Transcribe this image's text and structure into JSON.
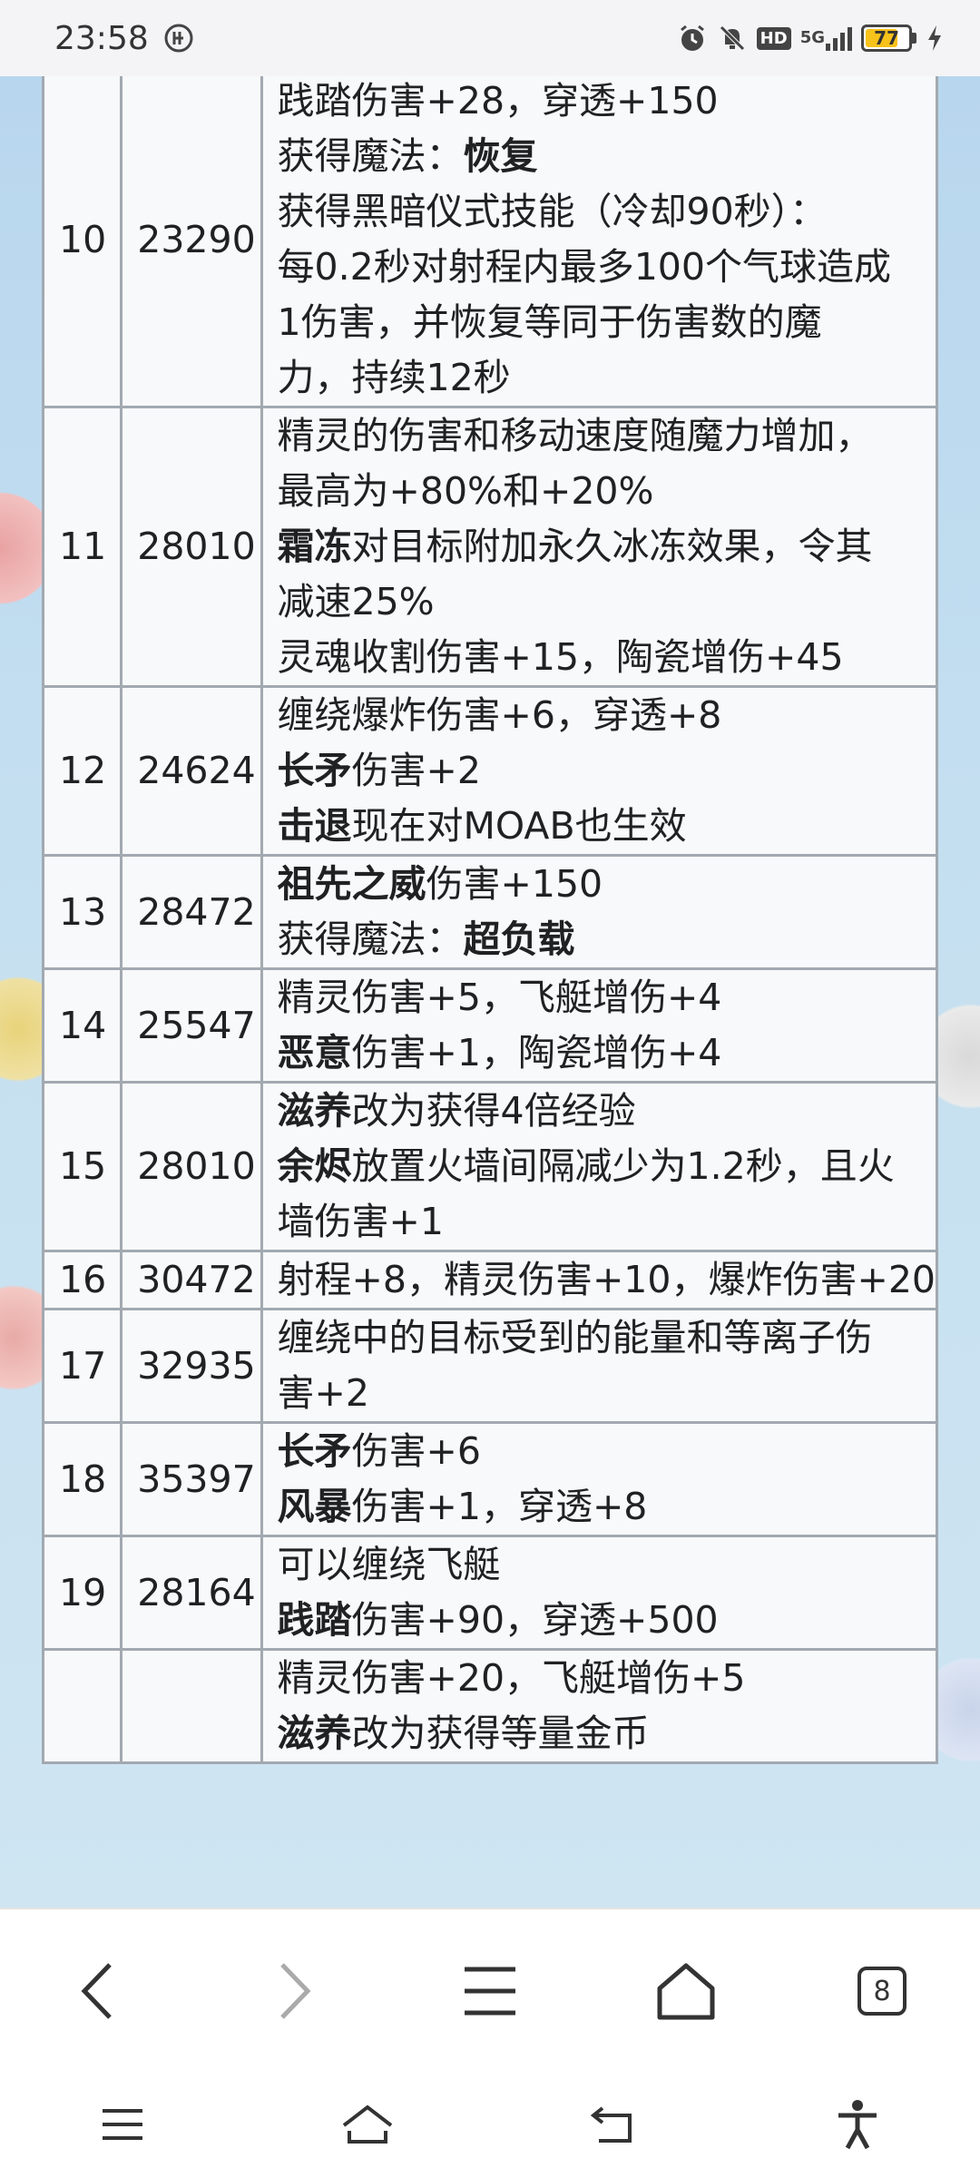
{
  "status_bar": {
    "time": "23:58",
    "network_label": "5G",
    "hd_label": "HD",
    "battery_level": "77",
    "icons": [
      "alarm-icon",
      "mute-icon",
      "hd-icon",
      "signal-icon",
      "battery-icon",
      "charging-icon"
    ]
  },
  "table": {
    "rows": [
      {
        "level": "10",
        "xp": "23290",
        "lines": [
          [
            {
              "t": "践踏伤害+28，穿透+150"
            }
          ],
          [
            {
              "t": "获得魔法："
            },
            {
              "t": "恢复",
              "b": true
            }
          ],
          [
            {
              "t": "获得黑暗仪式技能（冷却90秒）："
            }
          ],
          [
            {
              "t": "每0.2秒对射程内最多100个气球造成"
            }
          ],
          [
            {
              "t": "1伤害，并恢复等同于伤害数的魔"
            }
          ],
          [
            {
              "t": "力，持续12秒"
            }
          ]
        ]
      },
      {
        "level": "11",
        "xp": "28010",
        "lines": [
          [
            {
              "t": "精灵的伤害和移动速度随魔力增加，"
            }
          ],
          [
            {
              "t": "最高为+80%和+20%"
            }
          ],
          [
            {
              "t": "霜冻",
              "b": true
            },
            {
              "t": "对目标附加永久冰冻效果，令其"
            }
          ],
          [
            {
              "t": "减速25%"
            }
          ],
          [
            {
              "t": "灵魂收割伤害+15，陶瓷增伤+45"
            }
          ]
        ]
      },
      {
        "level": "12",
        "xp": "24624",
        "lines": [
          [
            {
              "t": "缠绕爆炸伤害+6，穿透+8"
            }
          ],
          [
            {
              "t": "长矛",
              "b": true
            },
            {
              "t": "伤害+2"
            }
          ],
          [
            {
              "t": "击退",
              "b": true
            },
            {
              "t": "现在对MOAB也生效"
            }
          ]
        ]
      },
      {
        "level": "13",
        "xp": "28472",
        "lines": [
          [
            {
              "t": "祖先之威",
              "b": true
            },
            {
              "t": "伤害+150"
            }
          ],
          [
            {
              "t": "获得魔法："
            },
            {
              "t": "超负载",
              "b": true
            }
          ]
        ]
      },
      {
        "level": "14",
        "xp": "25547",
        "lines": [
          [
            {
              "t": "精灵伤害+5，飞艇增伤+4"
            }
          ],
          [
            {
              "t": "恶意",
              "b": true
            },
            {
              "t": "伤害+1，陶瓷增伤+4"
            }
          ]
        ]
      },
      {
        "level": "15",
        "xp": "28010",
        "lines": [
          [
            {
              "t": "滋养",
              "b": true
            },
            {
              "t": "改为获得4倍经验"
            }
          ],
          [
            {
              "t": "余烬",
              "b": true
            },
            {
              "t": "放置火墙间隔减少为1.2秒，且火"
            }
          ],
          [
            {
              "t": "墙伤害+1"
            }
          ]
        ]
      },
      {
        "level": "16",
        "xp": "30472",
        "lines": [
          [
            {
              "t": "射程+8，精灵伤害+10，爆炸伤害+20"
            }
          ]
        ]
      },
      {
        "level": "17",
        "xp": "32935",
        "lines": [
          [
            {
              "t": "缠绕中的目标受到的能量和等离子伤"
            }
          ],
          [
            {
              "t": "害+2"
            }
          ]
        ]
      },
      {
        "level": "18",
        "xp": "35397",
        "lines": [
          [
            {
              "t": "长矛",
              "b": true
            },
            {
              "t": "伤害+6"
            }
          ],
          [
            {
              "t": "风暴",
              "b": true
            },
            {
              "t": "伤害+1，穿透+8"
            }
          ]
        ]
      },
      {
        "level": "19",
        "xp": "28164",
        "lines": [
          [
            {
              "t": "可以缠绕飞艇"
            }
          ],
          [
            {
              "t": "践踏",
              "b": true
            },
            {
              "t": "伤害+90，穿透+500"
            }
          ]
        ]
      },
      {
        "level": "",
        "xp": "",
        "lines": [
          [
            {
              "t": "精灵伤害+20，飞艇增伤+5"
            }
          ],
          [
            {
              "t": "滋养",
              "b": true
            },
            {
              "t": "改为获得等量金币"
            }
          ]
        ]
      }
    ]
  },
  "browser_bar": {
    "tab_count": "8",
    "icons": [
      "back-icon",
      "forward-icon",
      "menu-icon",
      "home-icon",
      "tabs-icon"
    ]
  },
  "system_nav": {
    "icons": [
      "recents-icon",
      "home-icon",
      "back-icon",
      "accessibility-icon"
    ]
  }
}
